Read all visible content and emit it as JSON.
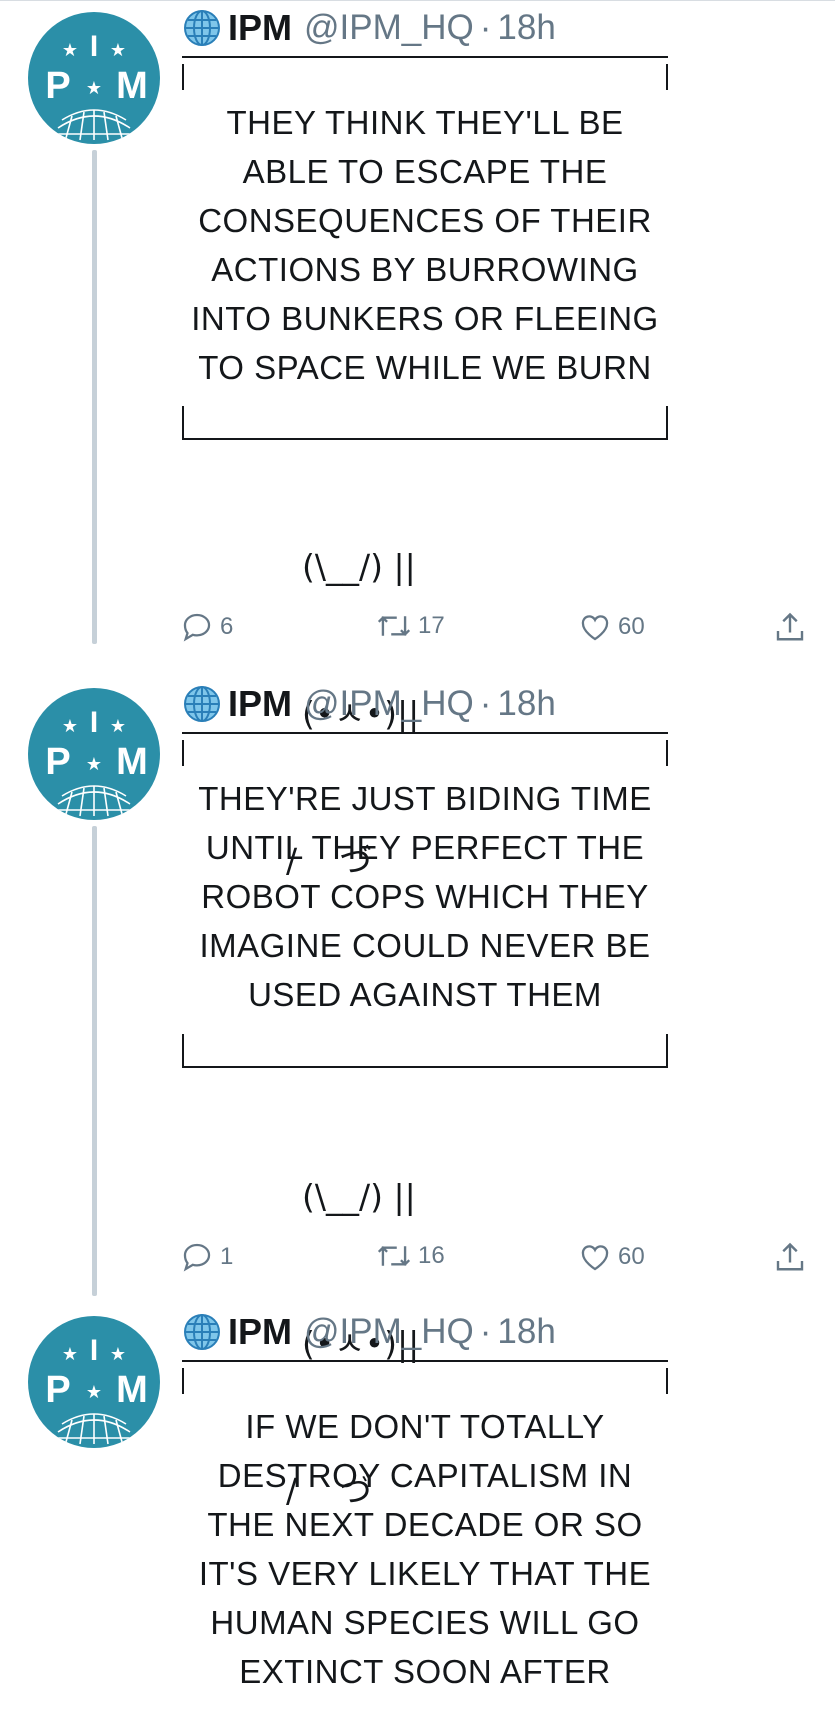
{
  "colors": {
    "avatar_bg": "#2b8fa8",
    "secondary_text": "#657786",
    "thread_line": "#c6d0d8"
  },
  "account": {
    "name": "IPM",
    "handle": "@IPM_HQ",
    "separator": "·",
    "avatar_letters": [
      "I",
      "P",
      "M"
    ],
    "name_icon": "globe-icon"
  },
  "tweets": [
    {
      "time": "18h",
      "sign_lines": "THEY THINK THEY'LL BE\nABLE TO ESCAPE THE\nCONSEQUENCES OF THEIR\nACTIONS BY BURROWING\nINTO BUNKERS OR FLEEING\nTO SPACE WHILE WE BURN",
      "bunny": [
        "(\\__/) ||",
        "(•ㅅ•)||",
        "/    づ"
      ],
      "replies": "6",
      "retweets": "17",
      "likes": "60"
    },
    {
      "time": "18h",
      "sign_lines": "THEY'RE JUST BIDING TIME\nUNTIL THEY PERFECT THE\nROBOT COPS WHICH THEY\nIMAGINE COULD NEVER BE\nUSED AGAINST THEM",
      "bunny": [
        "(\\__/) ||",
        "(•ㅅ•)||",
        "/    づ"
      ],
      "replies": "1",
      "retweets": "16",
      "likes": "60"
    },
    {
      "time": "18h",
      "sign_lines": "IF WE DON'T TOTALLY\nDESTROY CAPITALISM IN\nTHE NEXT DECADE OR SO\nIT'S VERY LIKELY THAT THE\nHUMAN SPECIES WILL GO\nEXTINCT SOON AFTER"
    }
  ]
}
